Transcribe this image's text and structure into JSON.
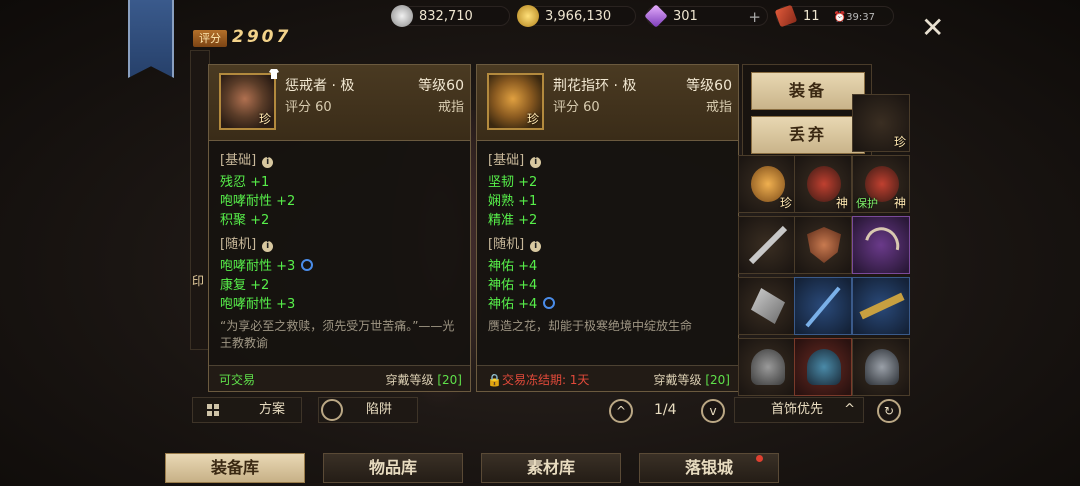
{
  "currency": {
    "silver": "832,710",
    "gold": "3,966,130",
    "diamond": "301",
    "ticket": "11",
    "timer": "⏰39:37"
  },
  "player": {
    "score_label": "评分",
    "score_value": "2907"
  },
  "left_card": {
    "name": "惩戒者 · 极",
    "level": "等级60",
    "score": "评分 60",
    "slot": "戒指",
    "rarity": "珍",
    "base_title": "[基础]",
    "base_stats": [
      "残忍 +1",
      "咆哮耐性 +2",
      "积聚 +2"
    ],
    "random_title": "[随机]",
    "random_stats": [
      "咆哮耐性 +3",
      "康复 +2",
      "咆哮耐性 +3"
    ],
    "lore": "“为享必至之救赎，须先受万世苦痛。”——光王教教谕",
    "trade": "可交易",
    "wear_label": "穿戴等级",
    "wear_value": "[20]"
  },
  "right_card": {
    "name": "荆花指环 · 极",
    "level": "等级60",
    "score": "评分 60",
    "slot": "戒指",
    "rarity": "珍",
    "base_title": "[基础]",
    "base_stats": [
      "坚韧 +2",
      "娴熟 +1",
      "精准 +2"
    ],
    "random_title": "[随机]",
    "random_stats": [
      "神佑 +4",
      "神佑 +4",
      "神佑 +4"
    ],
    "lore": "赝造之花，却能于极寒绝境中绽放生命",
    "trade": "🔒交易冻结期: 1天",
    "wear_label": "穿戴等级",
    "wear_value": "[20]"
  },
  "actions": {
    "equip": "装备",
    "discard": "丢弃"
  },
  "grid_labels": {
    "rare": "珍",
    "god": "神",
    "protect": "保护"
  },
  "controls": {
    "scheme": "方案",
    "trap": "陷阱",
    "page": "1/4",
    "sort": "首饰优先"
  },
  "tabs": [
    "装备库",
    "物品库",
    "素材库",
    "落银城"
  ],
  "left_slots": [
    "印"
  ]
}
